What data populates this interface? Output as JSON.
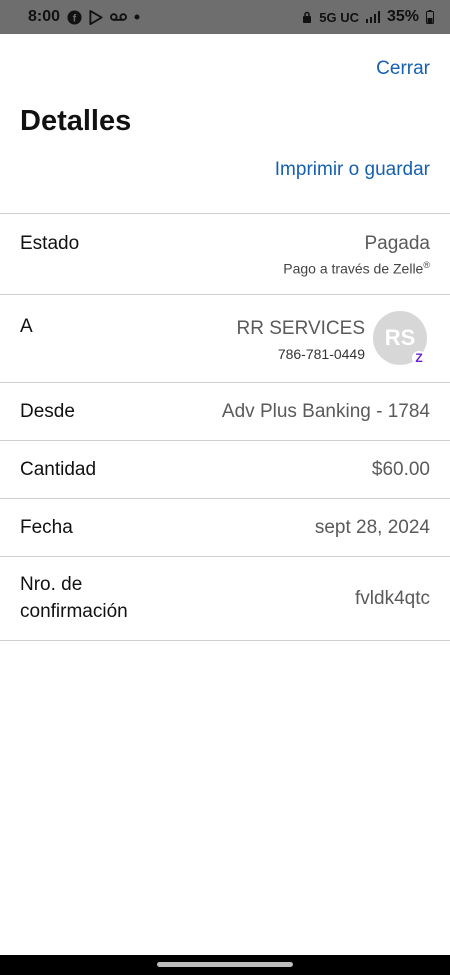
{
  "status_bar": {
    "time": "8:00",
    "network": "5G UC",
    "battery": "35%"
  },
  "header": {
    "close_label": "Cerrar",
    "title": "Detalles",
    "print_label": "Imprimir o guardar"
  },
  "details": {
    "estado": {
      "label": "Estado",
      "value": "Pagada",
      "sub": "Pago a través de Zelle"
    },
    "a": {
      "label": "A",
      "name": "RR SERVICES",
      "phone": "786-781-0449",
      "avatar_initials": "RS",
      "badge": "Z"
    },
    "desde": {
      "label": "Desde",
      "value": "Adv Plus Banking - 1784"
    },
    "cantidad": {
      "label": "Cantidad",
      "value": "$60.00"
    },
    "fecha": {
      "label": "Fecha",
      "value": "sept 28, 2024"
    },
    "confirmacion": {
      "label_line1": "Nro. de",
      "label_line2": "confirmación",
      "value": "fvldk4qtc"
    }
  },
  "colors": {
    "link": "#1560b0",
    "zelle": "#6d1ed4",
    "avatar_bg": "#d7d7d7"
  }
}
